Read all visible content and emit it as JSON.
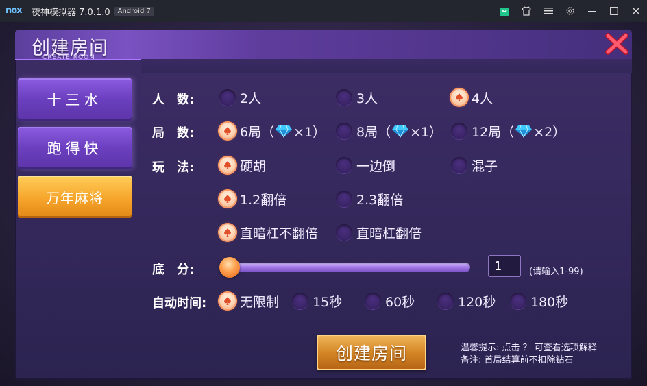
{
  "window": {
    "logo": "nox",
    "title": "夜神模拟器 7.0.1.0",
    "android_badge": "Android 7",
    "icons": [
      "store-icon",
      "shirt-icon",
      "menu-icon",
      "settings-icon",
      "minimize-icon",
      "maximize-icon",
      "close-icon"
    ]
  },
  "dialog": {
    "title": "创建房间",
    "subtitle": "CREATE ROOM",
    "close_icon": "red-x-icon"
  },
  "tabs": [
    {
      "label": "十三水",
      "state": "normal"
    },
    {
      "label": "跑得快",
      "state": "normal"
    },
    {
      "label": "万年麻将",
      "state": "active"
    }
  ],
  "rows": {
    "players": {
      "label": "人　数:",
      "options": [
        {
          "text": "2人",
          "selected": false
        },
        {
          "text": "3人",
          "selected": false
        },
        {
          "text": "4人",
          "selected": true
        }
      ]
    },
    "rounds": {
      "label": "局　数:",
      "options": [
        {
          "text": "6局（",
          "cost": "×1）",
          "selected": true
        },
        {
          "text": "8局（",
          "cost": "×1）",
          "selected": false
        },
        {
          "text": "12局（",
          "cost": "×2）",
          "selected": false
        }
      ]
    },
    "play": {
      "label": "玩　法:",
      "options": [
        {
          "text": "硬胡",
          "selected": true
        },
        {
          "text": "一边倒",
          "selected": false
        },
        {
          "text": "混子",
          "selected": false
        },
        {
          "text": "1.2翻倍",
          "selected": true
        },
        {
          "text": "2.3翻倍",
          "selected": false
        },
        {
          "text": "直暗杠不翻倍",
          "selected": true
        },
        {
          "text": "直暗杠翻倍",
          "selected": false
        }
      ]
    },
    "base_score": {
      "label": "底　分:",
      "value": "1",
      "hint": "(请输入1-99)",
      "slider_level": 0.0
    },
    "auto_time": {
      "label": "自动时间:",
      "options": [
        {
          "text": "无限制",
          "selected": true
        },
        {
          "text": "15秒",
          "selected": false
        },
        {
          "text": "60秒",
          "selected": false
        },
        {
          "text": "120秒",
          "selected": false
        },
        {
          "text": "180秒",
          "selected": false
        }
      ]
    }
  },
  "create_button": "创建房间",
  "tips": {
    "line1": "温馨提示:  点击  ？  可查看选项解释",
    "line2": "备注:  首局结算前不扣除钻石"
  },
  "colors": {
    "accent_orange": "#f6a52b",
    "tab_purple": "#6b3fbf",
    "close_red": "#e8304a",
    "diamond": "#4fd8ff"
  }
}
